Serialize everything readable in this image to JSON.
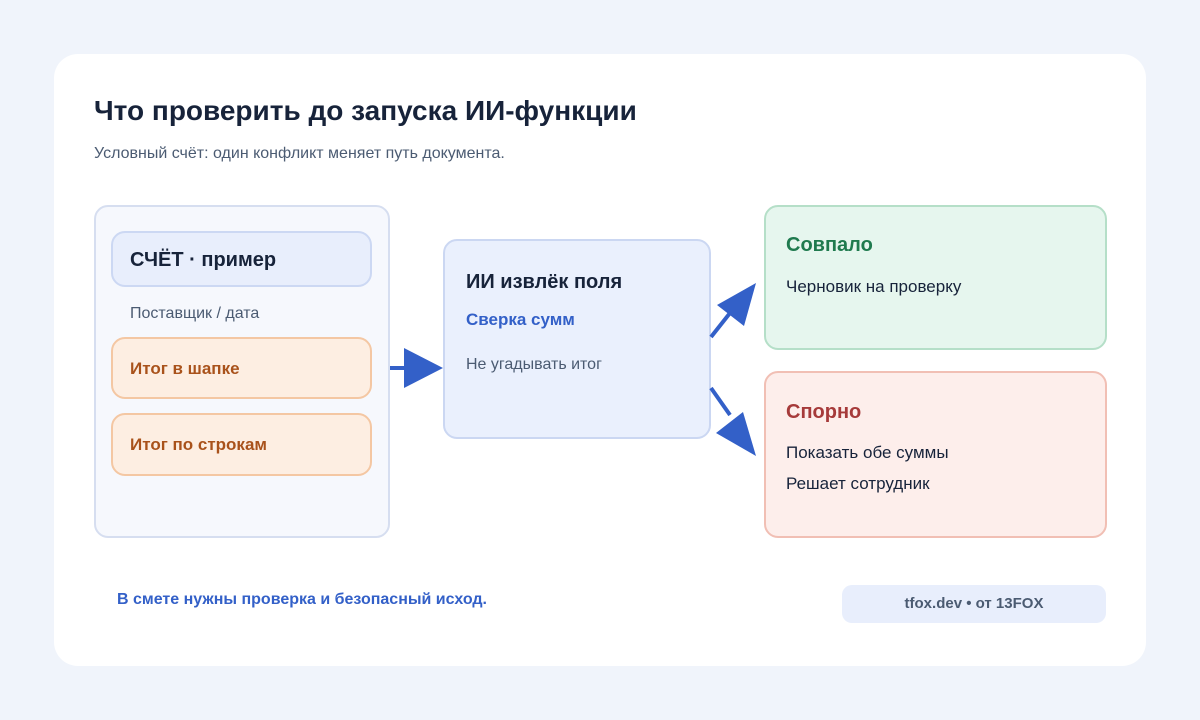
{
  "title": "Что проверить до запуска ИИ-функции",
  "subtitle": "Условный счёт: один конфликт меняет путь документа.",
  "document": {
    "header": "СЧЁТ · пример",
    "meta": "Поставщик / дата",
    "fields": [
      "Итог в шапке",
      "Итог по строкам"
    ]
  },
  "ai": {
    "title": "ИИ извлёк поля",
    "check": "Сверка сумм",
    "note": "Не угадывать итог"
  },
  "outcomes": {
    "match": {
      "title": "Совпало",
      "text": "Черновик на проверку"
    },
    "dispute": {
      "title": "Спорно",
      "lines": [
        "Показать обе суммы",
        "Решает сотрудник"
      ]
    }
  },
  "footnote": "В смете нужны проверка и безопасный исход.",
  "credit": "tfox.dev • от 13FOX",
  "colors": {
    "accent": "#3360c8",
    "match": "#1f7a4e",
    "dispute": "#a63a3a",
    "field": "#a9521b"
  }
}
